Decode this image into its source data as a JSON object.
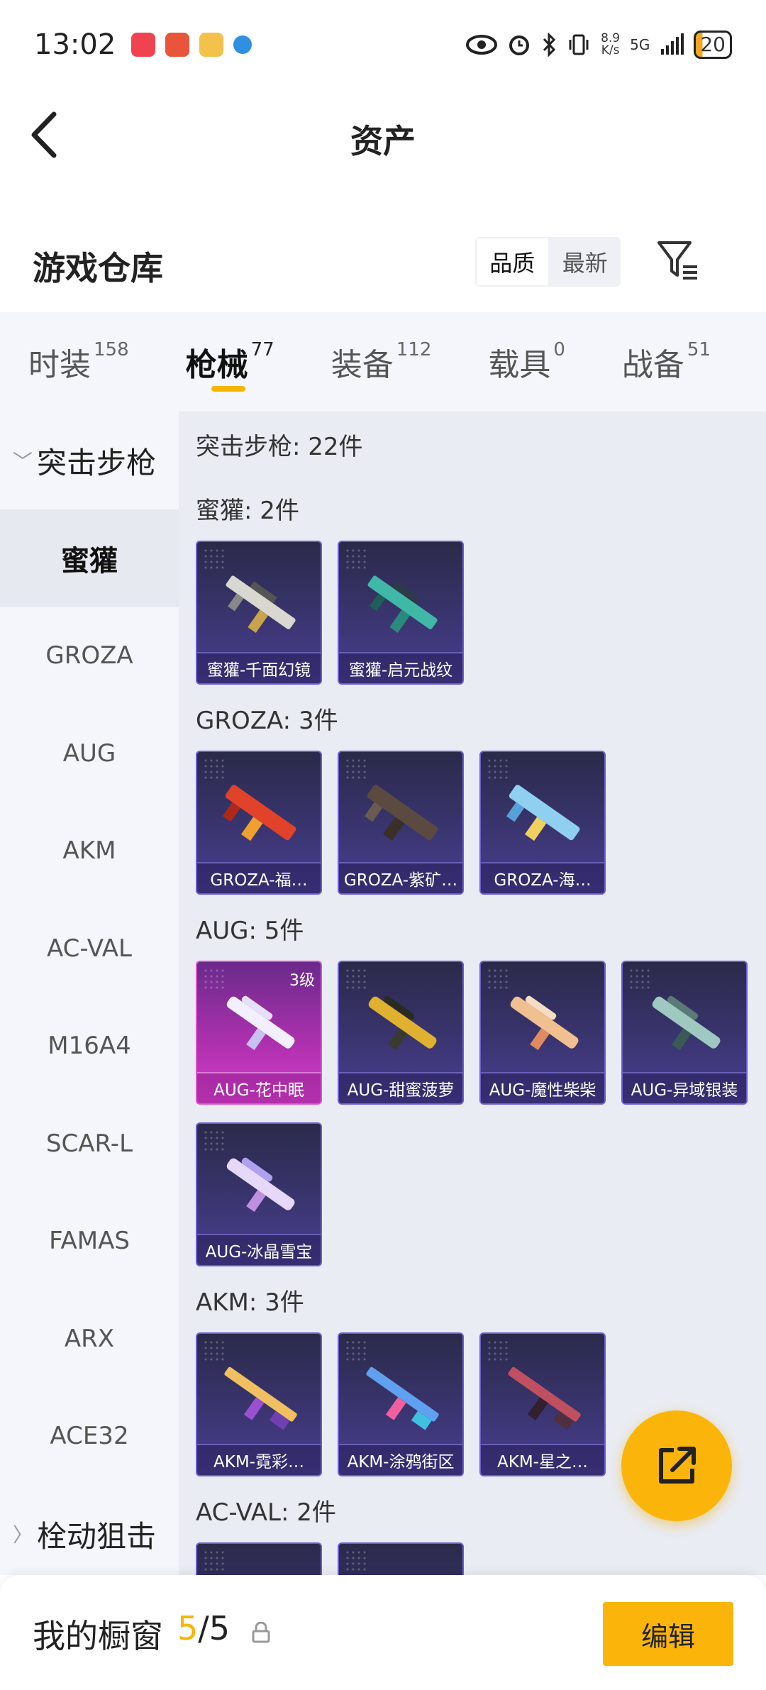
{
  "status_bar": {
    "time": "13:02",
    "net_speed_top": "8.9",
    "net_speed_bottom": "K/s",
    "network": "5G",
    "battery": "20"
  },
  "nav": {
    "title": "资产",
    "back_icon": "chevron-left-icon"
  },
  "warehouse": {
    "title": "游戏仓库",
    "sort_options": [
      "品质",
      "最新"
    ],
    "filter_icon": "filter-icon"
  },
  "tabs": [
    {
      "label": "时装",
      "count": "158",
      "active": false
    },
    {
      "label": "枪械",
      "count": "77",
      "active": true
    },
    {
      "label": "装备",
      "count": "112",
      "active": false
    },
    {
      "label": "载具",
      "count": "0",
      "active": false
    },
    {
      "label": "战备",
      "count": "51",
      "active": false
    }
  ],
  "sidebar": {
    "group_1": "突击步枪",
    "items": [
      "蜜獾",
      "GROZA",
      "AUG",
      "AKM",
      "AC-VAL",
      "M16A4",
      "SCAR-L",
      "FAMAS",
      "ARX",
      "ACE32"
    ],
    "group_2": "栓动狙击"
  },
  "main": {
    "summary": "突击步枪: 22件",
    "sections": [
      {
        "title": "蜜獾: 2件",
        "items": [
          "蜜獾-千面幻镜",
          "蜜獾-启元战纹"
        ]
      },
      {
        "title": "GROZA: 3件",
        "items": [
          "GROZA-福…",
          "GROZA-紫矿…",
          "GROZA-海…"
        ]
      },
      {
        "title": "AUG: 5件",
        "items": [
          "AUG-花中眠",
          "AUG-甜蜜菠萝",
          "AUG-魔性柴柴",
          "AUG-异域银装",
          "AUG-冰晶雪宝"
        ],
        "level_badge": "3级"
      },
      {
        "title": "AKM: 3件",
        "items": [
          "AKM-霓彩…",
          "AKM-涂鸦街区",
          "AKM-星之…"
        ]
      },
      {
        "title": "AC-VAL: 2件",
        "items": [
          "",
          ""
        ]
      }
    ]
  },
  "bottom": {
    "showcase_label": "我的橱窗",
    "used": "5",
    "sep": "/",
    "total": "5",
    "edit_label": "编辑"
  },
  "colors": {
    "accent": "#fbb50a",
    "card_purple": "#3a3570",
    "card_pink": "#b031b0"
  }
}
